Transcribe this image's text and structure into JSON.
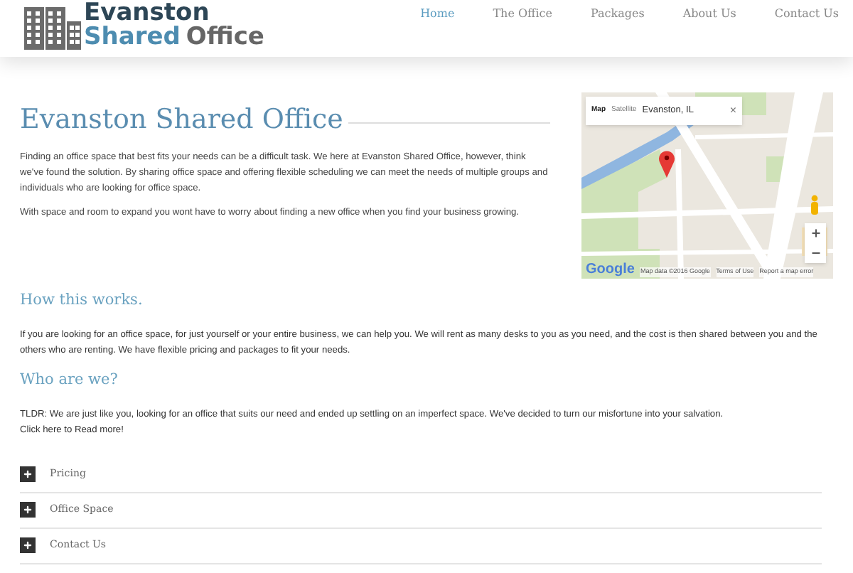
{
  "logo": {
    "line_1": "Evanston",
    "line_2_a": "Shared",
    "line_2_b": "Office"
  },
  "nav": [
    {
      "label": "Home",
      "selected": true
    },
    {
      "label": "The Office",
      "selected": false
    },
    {
      "label": "Packages",
      "selected": false
    },
    {
      "label": "About Us",
      "selected": false
    },
    {
      "label": "Contact Us",
      "selected": false
    }
  ],
  "intro": {
    "title": "Evanston Shared Office",
    "paragraphs": [
      "Finding an office space that best fits your needs can be a difficult task. We here at Evanston Shared Office, however, think we've found the solution. By sharing office space and offering flexible scheduling we can meet the needs of multiple groups and individuals who are looking for office space.",
      "With space and room to expand you wont have to worry about finding a new office when you find your business growing."
    ]
  },
  "map": {
    "type_buttons": [
      {
        "label": "Map",
        "selected": true
      },
      {
        "label": "Satellite",
        "selected": false
      }
    ],
    "info_text": "Evanston, IL",
    "close": "×",
    "logo": "Google",
    "footer": [
      "Map data ©2016 Google",
      "Terms of Use",
      "Report a map error"
    ]
  },
  "sections": [
    {
      "title": "How this works.",
      "paragraphs": [
        "If you are looking for an office space, for just yourself or your entire business, we can help you. We will rent as many desks to you as you need, and the cost is then shared between you and the others who are renting. We have flexible pricing and packages to fit your needs."
      ]
    },
    {
      "title": "Who are we?",
      "paragraphs": [
        "TLDR: We are just like you, looking for an office that suits our need and ended up settling on an imperfect space. We've decided to turn our misfortune into your salvation.",
        "Click here to Read more!"
      ]
    }
  ],
  "accordion": [
    {
      "label": "Pricing",
      "expanded": false
    },
    {
      "label": "Office Space",
      "expanded": false
    },
    {
      "label": "Contact Us",
      "expanded": false
    }
  ]
}
